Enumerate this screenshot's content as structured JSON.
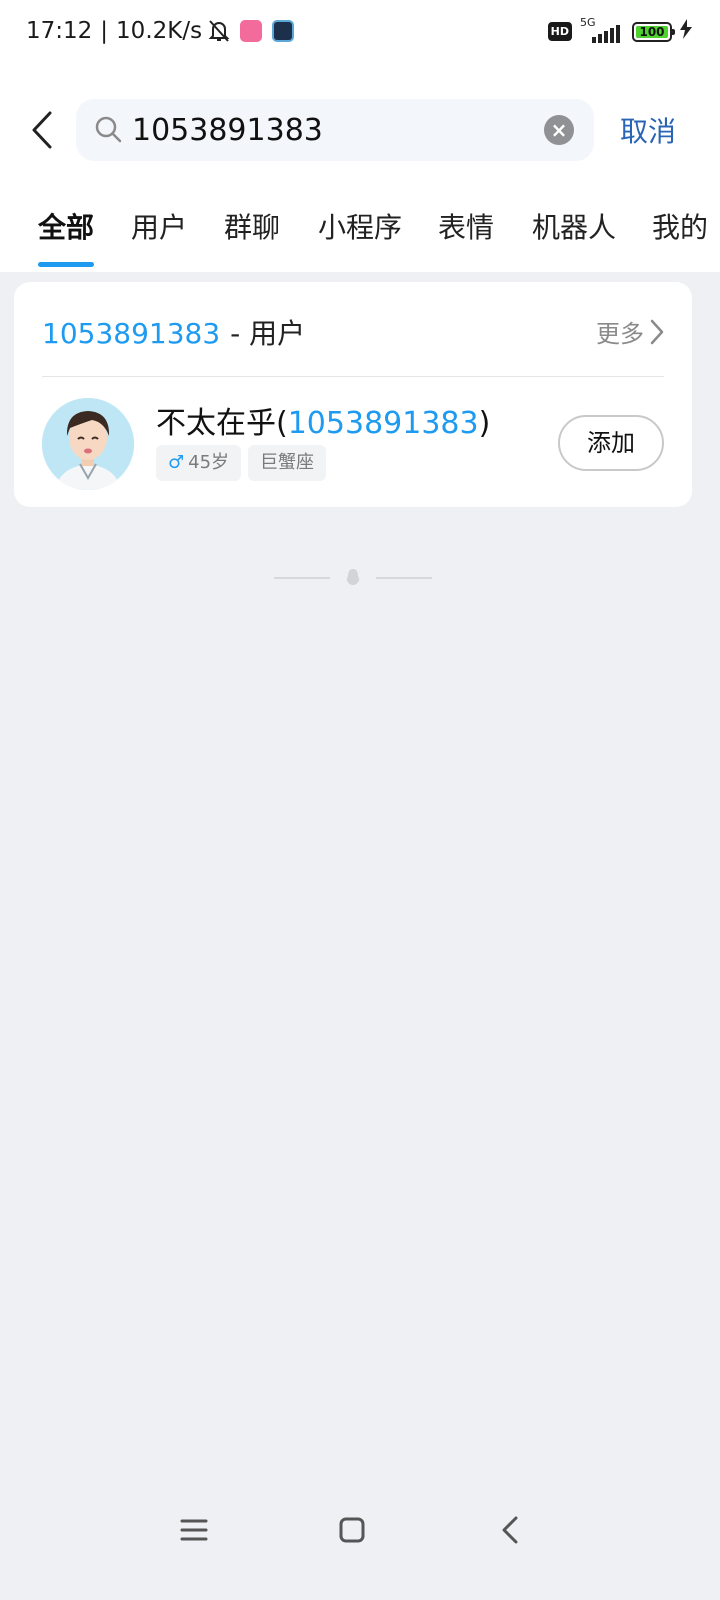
{
  "status_bar": {
    "time": "17:12",
    "net_speed": "10.2K/s",
    "hd": "HD",
    "network": "5G",
    "battery": "100",
    "icons": [
      "bell-off-icon",
      "bilibili-icon",
      "game-app-icon",
      "signal-icon",
      "battery-icon",
      "charging-icon"
    ]
  },
  "search": {
    "query": "1053891383",
    "cancel_label": "取消"
  },
  "tabs": [
    {
      "label": "全部",
      "active": true
    },
    {
      "label": "用户"
    },
    {
      "label": "群聊"
    },
    {
      "label": "小程序"
    },
    {
      "label": "表情"
    },
    {
      "label": "机器人"
    },
    {
      "label": "我的"
    }
  ],
  "result_section": {
    "query": "1053891383",
    "category": "- 用户",
    "more_label": "更多",
    "user": {
      "name_prefix": "不太在乎(",
      "name_highlight": "1053891383",
      "name_suffix": ")",
      "gender_symbol": "♂",
      "age": "45岁",
      "zodiac": "巨蟹座",
      "add_label": "添加"
    }
  },
  "colors": {
    "accent": "#1e9bf0",
    "cancel": "#2a64b4",
    "background": "#eff0f3"
  }
}
